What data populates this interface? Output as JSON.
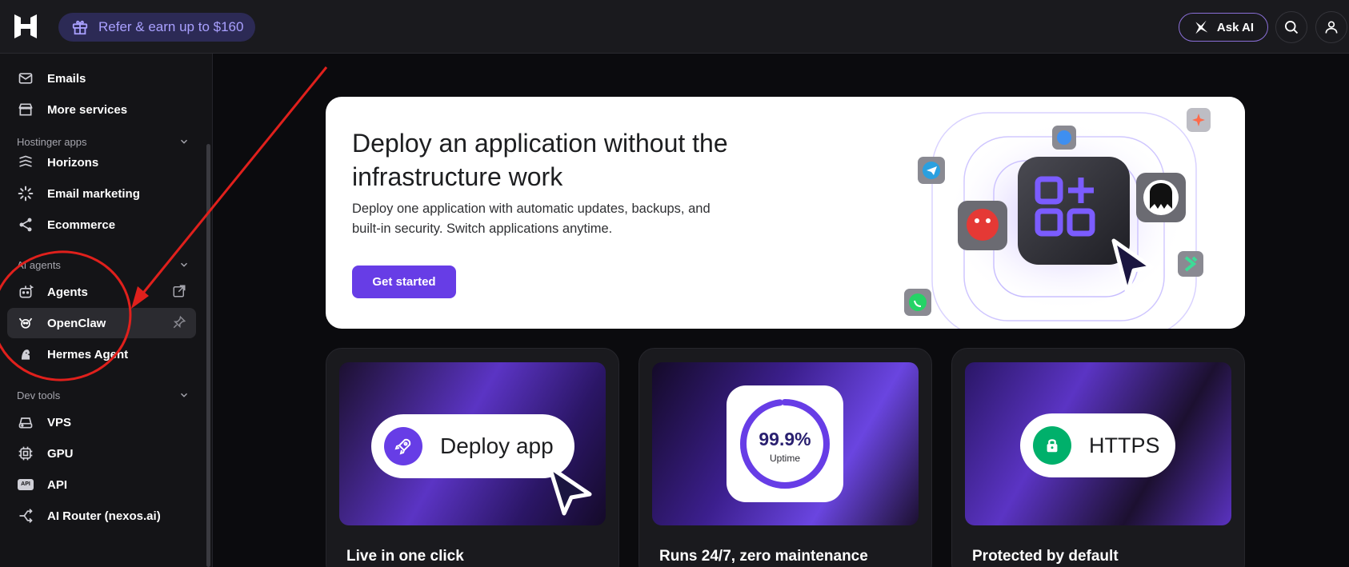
{
  "topbar": {
    "refer_label": "Refer & earn up to $160",
    "ask_ai_label": "Ask AI"
  },
  "sidebar": {
    "items_top": [
      {
        "label": "Emails",
        "icon": "mail-icon"
      },
      {
        "label": "More services",
        "icon": "store-icon"
      }
    ],
    "sections": [
      {
        "title": "Hostinger apps",
        "items": [
          {
            "label": "Horizons",
            "icon": "horizons-icon"
          },
          {
            "label": "Email marketing",
            "icon": "spinner-icon"
          },
          {
            "label": "Ecommerce",
            "icon": "share-nodes-icon"
          }
        ]
      },
      {
        "title": "AI agents",
        "items": [
          {
            "label": "Agents",
            "icon": "agent-icon",
            "trail": "external-link-icon"
          },
          {
            "label": "OpenClaw",
            "icon": "claw-icon",
            "trail": "pin-icon",
            "active": true
          },
          {
            "label": "Hermes Agent",
            "icon": "hermes-icon"
          }
        ]
      },
      {
        "title": "Dev tools",
        "items": [
          {
            "label": "VPS",
            "icon": "server-icon"
          },
          {
            "label": "GPU",
            "icon": "chip-icon"
          },
          {
            "label": "API",
            "icon": "api-icon"
          },
          {
            "label": "AI Router (nexos.ai)",
            "icon": "router-icon"
          }
        ]
      }
    ],
    "api_badge": "API"
  },
  "hero": {
    "title": "Deploy an application without the infrastructure work",
    "description": "Deploy one application with automatic updates, backups, and built-in security. Switch applications anytime.",
    "cta_label": "Get started"
  },
  "cards": [
    {
      "title": "Live in one click",
      "pill_label": "Deploy app"
    },
    {
      "title": "Runs 24/7, zero maintenance",
      "uptime_value": "99.9%",
      "uptime_label": "Uptime"
    },
    {
      "title": "Protected by default",
      "pill_label": "HTTPS"
    }
  ],
  "colors": {
    "accent": "#673de6",
    "annotation": "#e0201c"
  }
}
